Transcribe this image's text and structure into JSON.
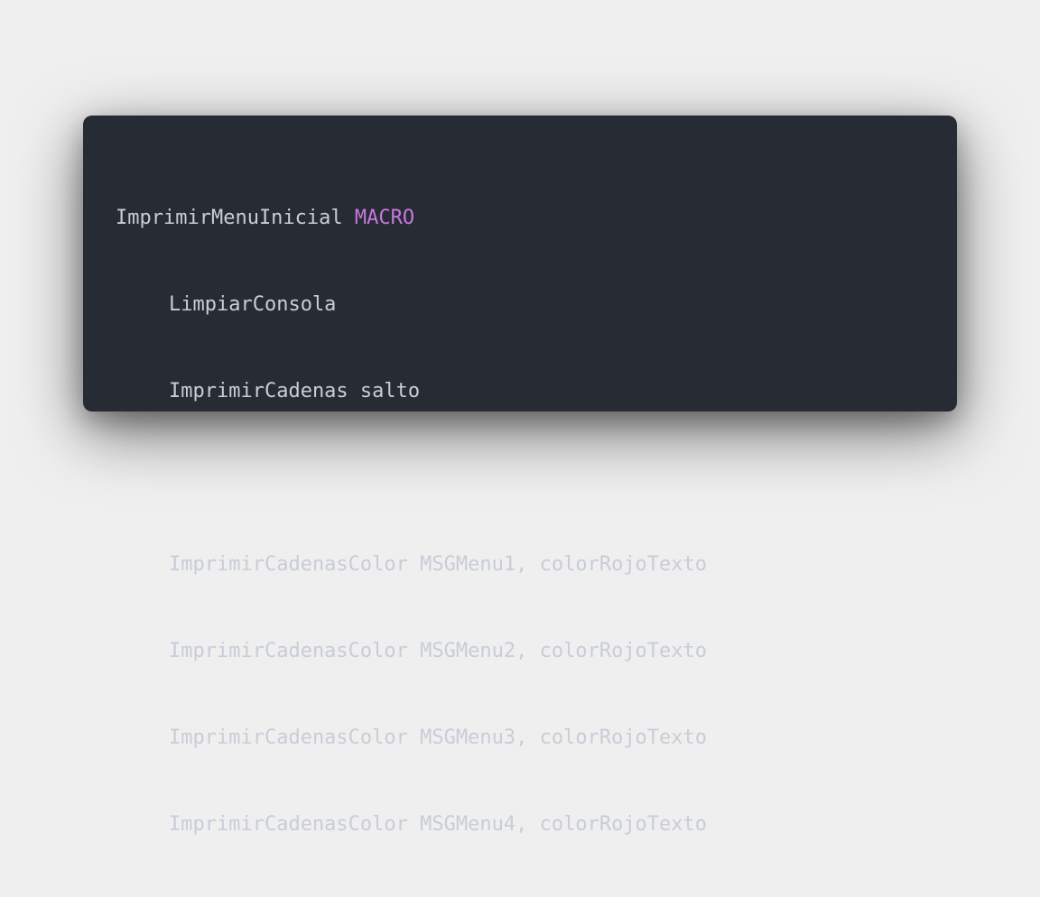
{
  "code": {
    "line1": {
      "name": "ImprimirMenuInicial",
      "keyword": "MACRO"
    },
    "line2": "LimpiarConsola",
    "line3": "ImprimirCadenas salto",
    "line4": "",
    "line5": "ImprimirCadenasColor MSGMenu1, colorRojoTexto",
    "line6": "ImprimirCadenasColor MSGMenu2, colorRojoTexto",
    "line7": "ImprimirCadenasColor MSGMenu3, colorRojoTexto",
    "line8": "ImprimirCadenasColor MSGMenu4, colorRojoTexto"
  },
  "colors": {
    "page_background": "#efefef",
    "window_background": "#272b34",
    "text": "#c8cdd6",
    "keyword": "#c678dd"
  }
}
